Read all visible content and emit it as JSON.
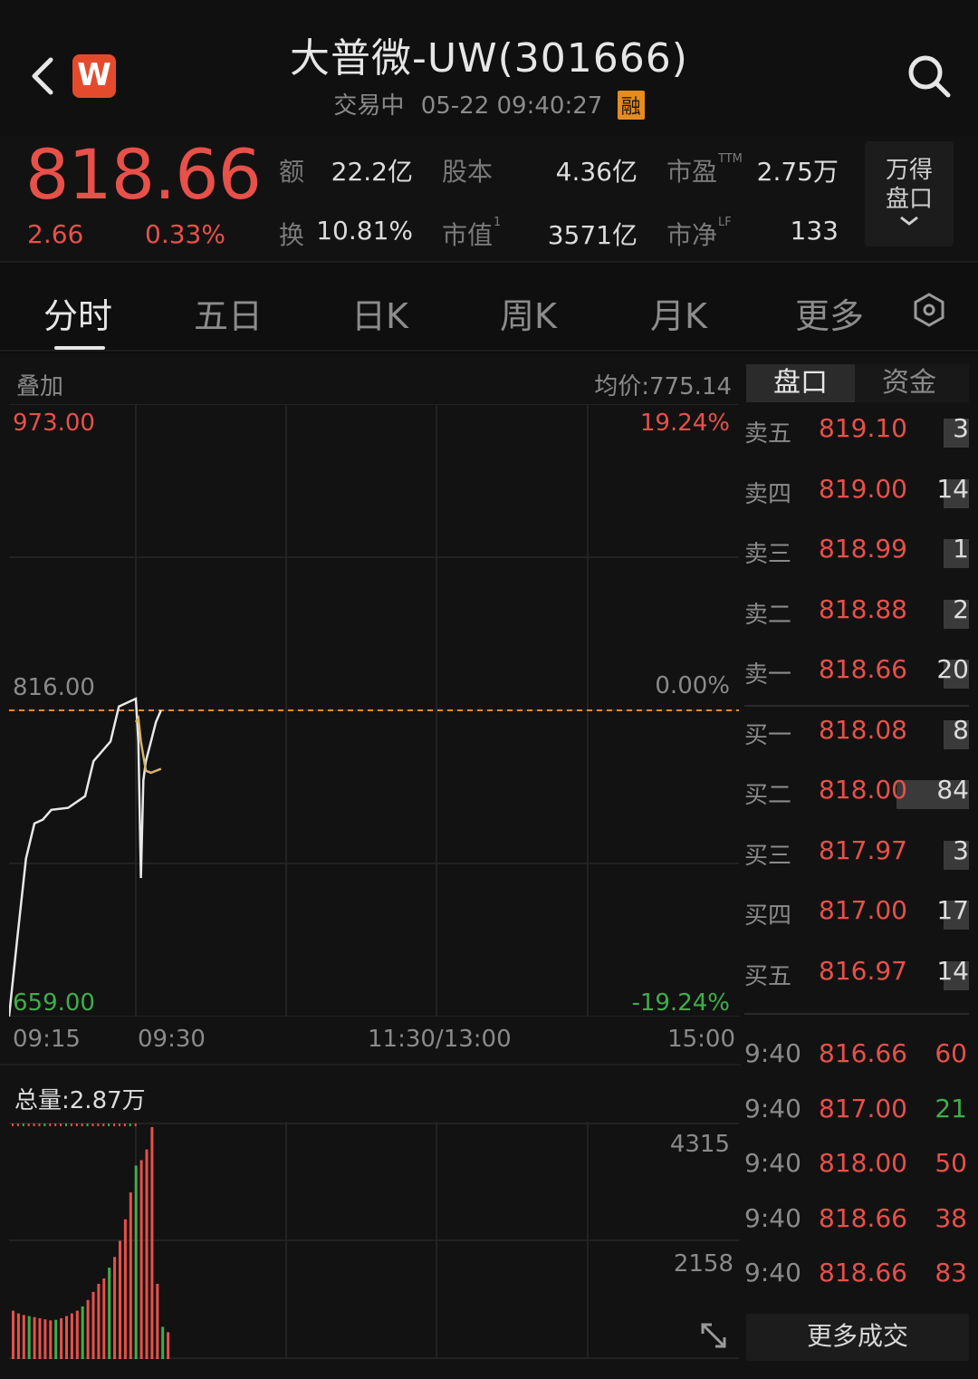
{
  "header": {
    "title": "大普微-UW(301666)",
    "status": "交易中",
    "datetime": "05-22 09:40:27",
    "margin_badge": "融",
    "logo_letter": "W"
  },
  "quote": {
    "price": "818.66",
    "change": "2.66",
    "change_pct": "0.33%",
    "items": [
      {
        "label": "额",
        "value": "22.2亿"
      },
      {
        "label": "股本",
        "value": "4.36亿"
      },
      {
        "label": "市盈",
        "sup": "TTM",
        "value": "2.75万"
      },
      {
        "label": "换",
        "value": "10.81%"
      },
      {
        "label": "市值",
        "sup": "1",
        "value": "3571亿"
      },
      {
        "label": "市净",
        "sup": "LF",
        "value": "133"
      }
    ],
    "wind_box": [
      "万得",
      "盘口"
    ]
  },
  "tabs": [
    "分时",
    "五日",
    "日K",
    "周K",
    "月K",
    "更多"
  ],
  "active_tab": "分时",
  "chart": {
    "overlay_label": "叠加",
    "avg_price_label": "均价:775.14",
    "y_top": "973.00",
    "y_top_pct": "19.24%",
    "y_mid": "816.00",
    "y_mid_pct": "0.00%",
    "y_bottom": "659.00",
    "y_bottom_pct": "-19.24%",
    "x_labels": [
      "09:15",
      "09:30",
      "11:30/13:00",
      "15:00"
    ],
    "volume_total": "总量:2.87万",
    "vol_top": "4315",
    "vol_mid": "2158"
  },
  "chart_data": {
    "type": "line",
    "ylim": [
      659.0,
      973.0
    ],
    "prev_close": 816.0,
    "price_series": [
      {
        "t": "09:15",
        "v": 659
      },
      {
        "t": "09:16",
        "v": 700
      },
      {
        "t": "09:17",
        "v": 740
      },
      {
        "t": "09:18",
        "v": 758
      },
      {
        "t": "09:19",
        "v": 760
      },
      {
        "t": "09:20",
        "v": 765
      },
      {
        "t": "09:22",
        "v": 766
      },
      {
        "t": "09:24",
        "v": 772
      },
      {
        "t": "09:25",
        "v": 790
      },
      {
        "t": "09:26",
        "v": 795
      },
      {
        "t": "09:27",
        "v": 800
      },
      {
        "t": "09:28",
        "v": 818
      },
      {
        "t": "09:30",
        "v": 822
      },
      {
        "t": "09:31",
        "v": 800
      },
      {
        "t": "09:32",
        "v": 730
      },
      {
        "t": "09:33",
        "v": 780
      },
      {
        "t": "09:34",
        "v": 790
      },
      {
        "t": "09:36",
        "v": 800
      },
      {
        "t": "09:38",
        "v": 810
      },
      {
        "t": "09:40",
        "v": 816
      }
    ],
    "avg_series": [
      {
        "t": "09:30",
        "v": 810
      },
      {
        "t": "09:31",
        "v": 812
      },
      {
        "t": "09:32",
        "v": 800
      },
      {
        "t": "09:34",
        "v": 785
      },
      {
        "t": "09:36",
        "v": 784
      },
      {
        "t": "09:40",
        "v": 786
      }
    ],
    "volume": [
      900,
      850,
      820,
      800,
      780,
      760,
      740,
      720,
      730,
      760,
      800,
      850,
      900,
      980,
      1100,
      1250,
      1400,
      1500,
      1700,
      1900,
      2200,
      2600,
      3100,
      3600,
      3700,
      3900,
      4315,
      1400,
      600,
      500
    ]
  },
  "order_book": {
    "tabs": [
      "盘口",
      "资金"
    ],
    "asks": [
      {
        "name": "卖五",
        "price": "819.10",
        "vol": "3",
        "frac": 0.04
      },
      {
        "name": "卖四",
        "price": "819.00",
        "vol": "14",
        "frac": 0.17
      },
      {
        "name": "卖三",
        "price": "818.99",
        "vol": "1",
        "frac": 0.02
      },
      {
        "name": "卖二",
        "price": "818.88",
        "vol": "2",
        "frac": 0.03
      },
      {
        "name": "卖一",
        "price": "818.66",
        "vol": "20",
        "frac": 0.24
      }
    ],
    "bids": [
      {
        "name": "买一",
        "price": "818.08",
        "vol": "8",
        "frac": 0.1
      },
      {
        "name": "买二",
        "price": "818.00",
        "vol": "84",
        "frac": 1.0
      },
      {
        "name": "买三",
        "price": "817.97",
        "vol": "3",
        "frac": 0.04
      },
      {
        "name": "买四",
        "price": "817.00",
        "vol": "17",
        "frac": 0.2
      },
      {
        "name": "买五",
        "price": "816.97",
        "vol": "14",
        "frac": 0.17
      }
    ]
  },
  "trades": [
    {
      "time": "9:40",
      "price": "816.66",
      "vol": "60",
      "color": "#e8504a"
    },
    {
      "time": "9:40",
      "price": "817.00",
      "vol": "21",
      "color": "#3fae4a"
    },
    {
      "time": "9:40",
      "price": "818.00",
      "vol": "50",
      "color": "#e8504a"
    },
    {
      "time": "9:40",
      "price": "818.66",
      "vol": "38",
      "color": "#e8504a"
    },
    {
      "time": "9:40",
      "price": "818.66",
      "vol": "83",
      "color": "#e8504a"
    }
  ],
  "more_trades": "更多成交"
}
